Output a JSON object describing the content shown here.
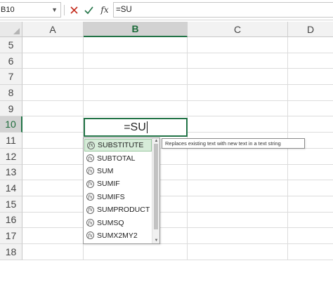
{
  "formula_bar": {
    "name_box": "B10",
    "cancel_icon": "close-icon",
    "enter_icon": "check-icon",
    "fx_label": "fx",
    "formula": "=SU"
  },
  "columns": [
    "A",
    "B",
    "C",
    "D"
  ],
  "selected_column": "B",
  "rows": [
    "5",
    "6",
    "7",
    "8",
    "9",
    "10",
    "11",
    "12",
    "13",
    "14",
    "15",
    "16",
    "17",
    "18"
  ],
  "selected_row": "10",
  "active_cell": {
    "ref": "B10",
    "value": "=SU"
  },
  "autocomplete": {
    "items": [
      "SUBSTITUTE",
      "SUBTOTAL",
      "SUM",
      "SUMIF",
      "SUMIFS",
      "SUMPRODUCT",
      "SUMSQ",
      "SUMX2MY2"
    ],
    "highlighted": "SUBSTITUTE",
    "tooltip": "Replaces existing text with new text in a text string"
  },
  "colors": {
    "accent": "#217346",
    "highlight": "#d7ecd9",
    "cancel": "#c42b1c",
    "enter": "#217346"
  }
}
